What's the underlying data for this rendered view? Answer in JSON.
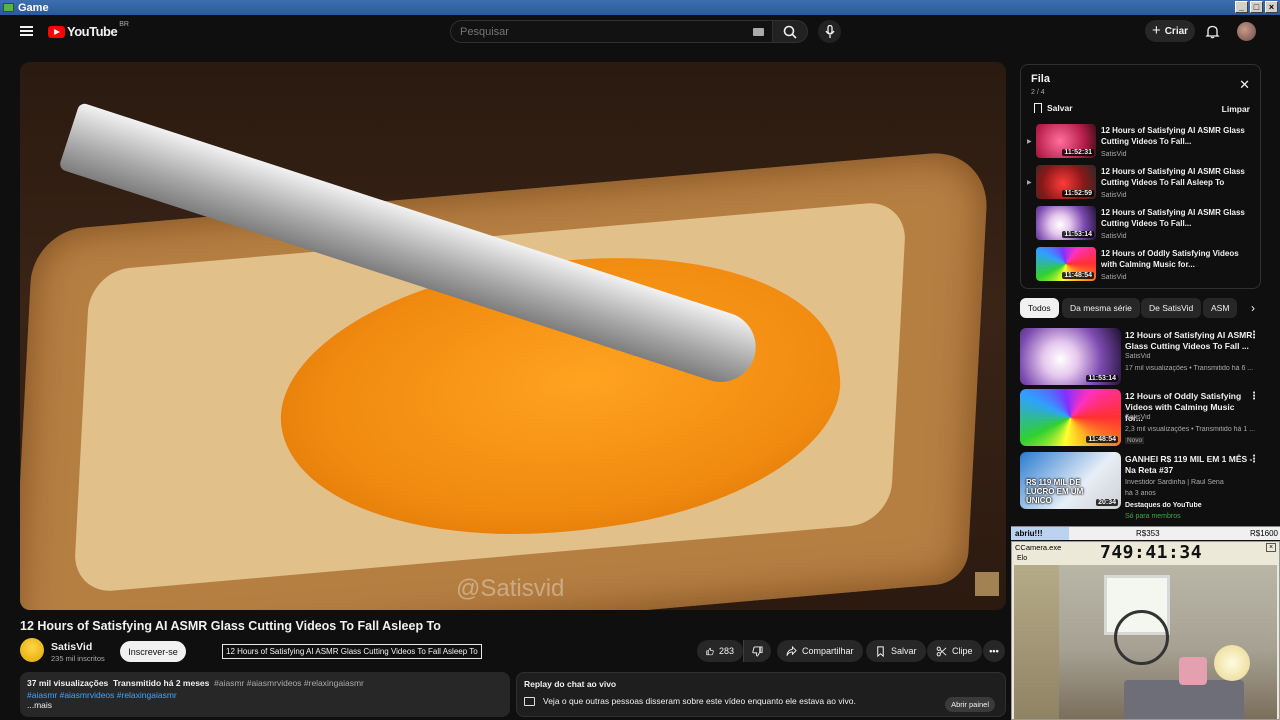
{
  "window": {
    "title": "Game"
  },
  "header": {
    "logo_text": "YouTube",
    "country_code": "BR",
    "search_placeholder": "Pesquisar",
    "create_label": "Criar"
  },
  "video": {
    "watermark": "@Satisvid",
    "title": "12 Hours of Satisfying AI ASMR Glass Cutting Videos To Fall Asleep To",
    "tooltip": "12 Hours of Satisfying AI ASMR Glass Cutting Videos To Fall Asleep To"
  },
  "channel": {
    "name": "SatisVid",
    "subscribers": "235 mil inscritos",
    "subscribe_label": "Inscrever-se"
  },
  "actions": {
    "likes": "283",
    "share_label": "Compartilhar",
    "save_label": "Salvar",
    "clip_label": "Clipe"
  },
  "description": {
    "views": "37 mil visualizações",
    "streamed": "Transmitido há 2 meses",
    "hashtags_gray": "#aiasmr #aiasmrvideos #relaxingaiasmr",
    "hashtags_blue": "#aiasmr #aiasmrvideos #relaxingaiasmr",
    "more": "...mais"
  },
  "chat_replay": {
    "title": "Replay do chat ao vivo",
    "text": "Veja o que outras pessoas disseram sobre este vídeo enquanto ele estava ao vivo.",
    "open_label": "Abrir painel"
  },
  "queue": {
    "title": "Fila",
    "count": "2 / 4",
    "save_label": "Salvar",
    "clear_label": "Limpar",
    "items": [
      {
        "title": "12 Hours of Satisfying AI ASMR Glass Cutting Videos To Fall...",
        "channel": "SatisVid",
        "duration": "11:52:31"
      },
      {
        "title": "12 Hours of Satisfying AI ASMR Glass Cutting Videos To Fall Asleep To",
        "channel": "SatisVid",
        "duration": "11:52:59"
      },
      {
        "title": "12 Hours of Satisfying AI ASMR Glass Cutting Videos To Fall...",
        "channel": "SatisVid",
        "duration": "11:53:14"
      },
      {
        "title": "12 Hours of Oddly Satisfying Videos with Calming Music for...",
        "channel": "SatisVid",
        "duration": "11:48:54"
      }
    ]
  },
  "chips": [
    "Todos",
    "Da mesma série",
    "De SatisVid",
    "ASM"
  ],
  "recommended": [
    {
      "title": "12 Hours of Satisfying AI ASMR Glass Cutting Videos To Fall ...",
      "channel": "SatisVid",
      "meta": "17 mil visualizações • Transmitido há 6 ...",
      "duration": "11:53:14"
    },
    {
      "title": "12 Hours of Oddly Satisfying Videos with Calming Music for...",
      "channel": "SatisVid",
      "meta": "2,3 mil visualizações • Transmitido há 1 ...",
      "badge": "Novo",
      "duration": "11:48:54"
    },
    {
      "title": "GANHEI R$ 119 MIL EM 1 MÊS - Na Reta #37",
      "channel": "Investidor Sardinha | Raul Sena",
      "meta": "há 3 anos",
      "extra": "Destaques do YouTube",
      "member": "Só para membros",
      "duration": "20:34",
      "thumb_text": "R$ 119 MIL DE LUCRO EM UM ÚNICO"
    }
  ],
  "overlay": {
    "bar_label": "abriu!!!",
    "amount_mid": "R$353",
    "amount_right": "R$1600",
    "cam_title": "CCamera.exe",
    "cam_sub": "Elo",
    "clock": "749:41:34"
  }
}
